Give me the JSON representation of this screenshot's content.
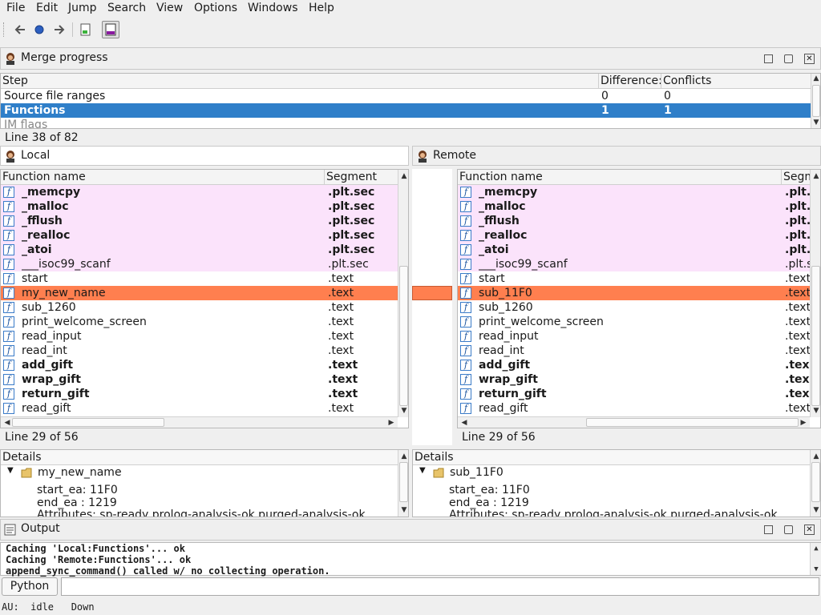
{
  "menu": [
    "File",
    "Edit",
    "Jump",
    "Search",
    "View",
    "Options",
    "Windows",
    "Help"
  ],
  "toolbar": {
    "icons": [
      "back-arrow-icon",
      "circle-icon",
      "forward-arrow-icon",
      "graph-view-icon",
      "window-toggle-icon"
    ]
  },
  "merge_progress": {
    "title": "Merge progress",
    "columns": [
      "Step",
      "Difference:",
      "Conflicts"
    ],
    "rows": [
      {
        "step": "Source file ranges",
        "differences": "0",
        "conflicts": "0"
      },
      {
        "step": "Functions",
        "differences": "1",
        "conflicts": "1"
      },
      {
        "step": "IM flags",
        "differences": "",
        "conflicts": ""
      }
    ],
    "line_status": "Line 38 of 82"
  },
  "local": {
    "title": "Local",
    "columns": [
      "Function name",
      "Segment"
    ],
    "line_status": "Line 29 of 56",
    "details": {
      "header": "Details",
      "node": "my_new_name",
      "start_ea": "start_ea: 11F0",
      "end_ea": "end_ea : 1219",
      "attributes": "Attributes: sp-ready,prolog-analysis-ok,purged-analysis-ok"
    }
  },
  "remote": {
    "title": "Remote",
    "columns": [
      "Function name",
      "Segm"
    ],
    "line_status": "Line 29 of 56",
    "details": {
      "header": "Details",
      "node": "sub_11F0",
      "start_ea": "start_ea: 11F0",
      "end_ea": "end_ea : 1219",
      "attributes": "Attributes: sp-ready,prolog-analysis-ok,purged-analysis-ok"
    }
  },
  "functions": [
    {
      "local": "_memcpy",
      "remote": "_memcpy",
      "local_seg": ".plt.sec",
      "remote_seg": ".plt.",
      "style": "pink-bold"
    },
    {
      "local": "_malloc",
      "remote": "_malloc",
      "local_seg": ".plt.sec",
      "remote_seg": ".plt.",
      "style": "pink-bold"
    },
    {
      "local": "_fflush",
      "remote": "_fflush",
      "local_seg": ".plt.sec",
      "remote_seg": ".plt.",
      "style": "pink-bold"
    },
    {
      "local": "_realloc",
      "remote": "_realloc",
      "local_seg": ".plt.sec",
      "remote_seg": ".plt.",
      "style": "pink-bold"
    },
    {
      "local": "_atoi",
      "remote": "_atoi",
      "local_seg": ".plt.sec",
      "remote_seg": ".plt.",
      "style": "pink-bold"
    },
    {
      "local": "___isoc99_scanf",
      "remote": "___isoc99_scanf",
      "local_seg": ".plt.sec",
      "remote_seg": ".plt.s",
      "style": "pink"
    },
    {
      "local": "start",
      "remote": "start",
      "local_seg": ".text",
      "remote_seg": ".text",
      "style": "normal"
    },
    {
      "local": "my_new_name",
      "remote": "sub_11F0",
      "local_seg": ".text",
      "remote_seg": ".text",
      "style": "selected"
    },
    {
      "local": "sub_1260",
      "remote": "sub_1260",
      "local_seg": ".text",
      "remote_seg": ".text",
      "style": "normal"
    },
    {
      "local": "print_welcome_screen",
      "remote": "print_welcome_screen",
      "local_seg": ".text",
      "remote_seg": ".text",
      "style": "normal"
    },
    {
      "local": "read_input",
      "remote": "read_input",
      "local_seg": ".text",
      "remote_seg": ".text",
      "style": "normal"
    },
    {
      "local": "read_int",
      "remote": "read_int",
      "local_seg": ".text",
      "remote_seg": ".text",
      "style": "normal"
    },
    {
      "local": "add_gift",
      "remote": "add_gift",
      "local_seg": ".text",
      "remote_seg": ".tex",
      "style": "bold"
    },
    {
      "local": "wrap_gift",
      "remote": "wrap_gift",
      "local_seg": ".text",
      "remote_seg": ".tex",
      "style": "bold"
    },
    {
      "local": "return_gift",
      "remote": "return_gift",
      "local_seg": ".text",
      "remote_seg": ".tex",
      "style": "bold"
    },
    {
      "local": "read_gift",
      "remote": "read_gift",
      "local_seg": ".text",
      "remote_seg": ".text",
      "style": "normal"
    }
  ],
  "output": {
    "title": "Output",
    "lines": [
      "Caching 'Local:Functions'... ok",
      "Caching 'Remote:Functions'... ok",
      "append_sync_command() called w/ no collecting operation."
    ],
    "python_label": "Python",
    "command_value": ""
  },
  "statusbar": {
    "text": "AU:  idle   Down"
  },
  "colors": {
    "selected_row": "#ff7f4f",
    "diff_row": "#fbe3fb",
    "active_row": "#2f7fc9"
  }
}
